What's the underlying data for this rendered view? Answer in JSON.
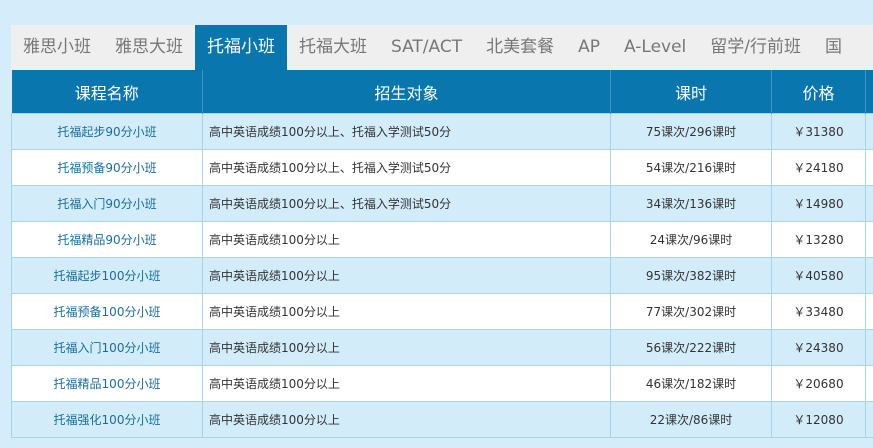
{
  "tabs": [
    {
      "label": "雅思小班",
      "active": false
    },
    {
      "label": "雅思大班",
      "active": false
    },
    {
      "label": "托福小班",
      "active": true
    },
    {
      "label": "托福大班",
      "active": false
    },
    {
      "label": "SAT/ACT",
      "active": false
    },
    {
      "label": "北美套餐",
      "active": false
    },
    {
      "label": "AP",
      "active": false
    },
    {
      "label": "A-Level",
      "active": false
    },
    {
      "label": "留学/行前班",
      "active": false
    },
    {
      "label": "国",
      "active": false
    }
  ],
  "table": {
    "headers": [
      "课程名称",
      "招生对象",
      "课时",
      "价格",
      ""
    ],
    "rows": [
      {
        "name": "托福起步90分小班",
        "target": "高中英语成绩100分以上、托福入学测试50分",
        "hours": "75课次/296课时",
        "price": "￥31380"
      },
      {
        "name": "托福预备90分小班",
        "target": "高中英语成绩100分以上、托福入学测试50分",
        "hours": "54课次/216课时",
        "price": "￥24180"
      },
      {
        "name": "托福入门90分小班",
        "target": "高中英语成绩100分以上、托福入学测试50分",
        "hours": "34课次/136课时",
        "price": "￥14980"
      },
      {
        "name": "托福精品90分小班",
        "target": "高中英语成绩100分以上",
        "hours": "24课次/96课时",
        "price": "￥13280"
      },
      {
        "name": "托福起步100分小班",
        "target": "高中英语成绩100分以上",
        "hours": "95课次/382课时",
        "price": "￥40580"
      },
      {
        "name": "托福预备100分小班",
        "target": "高中英语成绩100分以上",
        "hours": "77课次/302课时",
        "price": "￥33480"
      },
      {
        "name": "托福入门100分小班",
        "target": "高中英语成绩100分以上",
        "hours": "56课次/222课时",
        "price": "￥24380"
      },
      {
        "name": "托福精品100分小班",
        "target": "高中英语成绩100分以上",
        "hours": "46课次/182课时",
        "price": "￥20680"
      },
      {
        "name": "托福强化100分小班",
        "target": "高中英语成绩100分以上",
        "hours": "22课次/86课时",
        "price": "￥12080"
      }
    ]
  },
  "colors": {
    "accent": "#0a76ae",
    "row_alt": "#d3ecfa",
    "page_bg": "#d5edfb"
  }
}
